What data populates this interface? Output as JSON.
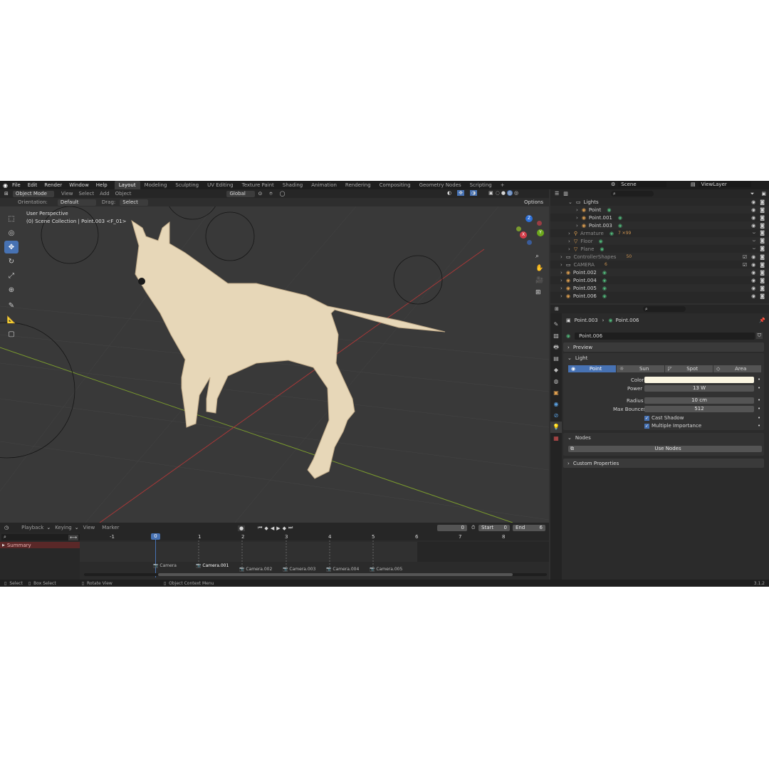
{
  "topbar": {
    "menus": [
      "File",
      "Edit",
      "Render",
      "Window",
      "Help"
    ],
    "workspaces": [
      "Layout",
      "Modeling",
      "Sculpting",
      "UV Editing",
      "Texture Paint",
      "Shading",
      "Animation",
      "Rendering",
      "Compositing",
      "Geometry Nodes",
      "Scripting"
    ],
    "active_workspace": "Layout",
    "add_tab": "+",
    "scene": "Scene",
    "view_layer": "ViewLayer"
  },
  "viewport_header": {
    "mode": "Object Mode",
    "menus": [
      "View",
      "Select",
      "Add",
      "Object"
    ],
    "transform": "Global",
    "orientation_label": "Orientation:",
    "orientation_value": "Default",
    "drag_label": "Drag:",
    "drag_value": "Select Box",
    "options": "Options"
  },
  "viewport": {
    "perspective": "User Perspective",
    "collection": "(0) Scene Collection | Point.003 <F_01>",
    "gizmo": {
      "z": "Z",
      "y": "Y",
      "x": "X"
    }
  },
  "outliner": {
    "items": [
      {
        "name": "Lights",
        "indent": 1,
        "icon": "collection"
      },
      {
        "name": "Point",
        "indent": 2,
        "icon": "light"
      },
      {
        "name": "Point.001",
        "indent": 2,
        "icon": "light"
      },
      {
        "name": "Point.003",
        "indent": 2,
        "icon": "light"
      },
      {
        "name": "Armature",
        "indent": 1,
        "icon": "armature",
        "extra": "7 ✕99"
      },
      {
        "name": "Floor",
        "indent": 1,
        "icon": "mesh"
      },
      {
        "name": "Plane",
        "indent": 1,
        "icon": "mesh"
      },
      {
        "name": "ControllerShapes",
        "indent": 0,
        "icon": "collection",
        "extra": "50"
      },
      {
        "name": "CAMERA",
        "indent": 0,
        "icon": "collection",
        "extra": "6"
      },
      {
        "name": "Point.002",
        "indent": 0,
        "icon": "light"
      },
      {
        "name": "Point.004",
        "indent": 0,
        "icon": "light"
      },
      {
        "name": "Point.005",
        "indent": 0,
        "icon": "light"
      },
      {
        "name": "Point.006",
        "indent": 0,
        "icon": "light"
      }
    ]
  },
  "properties": {
    "breadcrumb_object": "Point.003",
    "breadcrumb_data": "Point.006",
    "datablock": "Point.006",
    "preview_label": "Preview",
    "light_label": "Light",
    "light_types": [
      "Point",
      "Sun",
      "Spot",
      "Area"
    ],
    "active_light_type": "Point",
    "color_label": "Color",
    "color_value": "#fbf6e2",
    "power_label": "Power",
    "power_value": "13 W",
    "radius_label": "Radius",
    "radius_value": "10 cm",
    "max_bounces_label": "Max Bounces",
    "max_bounces_value": "512",
    "cast_shadow": "Cast Shadow",
    "multiple_importance": "Multiple Importance",
    "nodes_label": "Nodes",
    "use_nodes": "Use Nodes",
    "custom_props": "Custom Properties"
  },
  "timeline": {
    "menus": [
      "Playback",
      "Keying",
      "View",
      "Marker"
    ],
    "current_frame": "0",
    "start_label": "Start",
    "start_value": "0",
    "end_label": "End",
    "end_value": "6",
    "playhead": "0",
    "ticks": [
      "-1",
      "1",
      "2",
      "3",
      "4",
      "5",
      "6",
      "7",
      "8"
    ],
    "summary": "Summary",
    "markers": [
      "Camera",
      "Camera.001",
      "Camera.002",
      "Camera.003",
      "Camera.004",
      "Camera.005"
    ]
  },
  "statusbar": {
    "select": "Select",
    "box_select": "Box Select",
    "rotate_view": "Rotate View",
    "context_menu": "Object Context Menu",
    "version": "3.1.2"
  },
  "colors": {
    "accent": "#4772b3",
    "light_icon": "#50b478"
  }
}
